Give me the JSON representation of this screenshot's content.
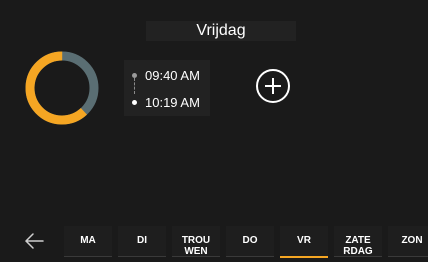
{
  "header": {
    "day_title": "Vrijdag"
  },
  "colors": {
    "background": "#1a1a1a",
    "accent": "#f5a623",
    "donut_gray": "#5a6e73"
  },
  "donut": {
    "orange_fraction": 0.62,
    "gray_fraction": 0.38
  },
  "schedule": {
    "start_time": "09:40 AM",
    "end_time": "10:19 AM"
  },
  "add_button": {
    "icon": "plus-icon"
  },
  "nav": {
    "back_icon": "arrow-left-icon"
  },
  "days": [
    {
      "label": "MA",
      "active": false
    },
    {
      "label": "DI",
      "active": false
    },
    {
      "label": "TROU WEN",
      "active": false
    },
    {
      "label": "DO",
      "active": false
    },
    {
      "label": "VR",
      "active": true
    },
    {
      "label": "ZATE RDAG",
      "active": false
    },
    {
      "label": "ZON",
      "active": false
    }
  ]
}
